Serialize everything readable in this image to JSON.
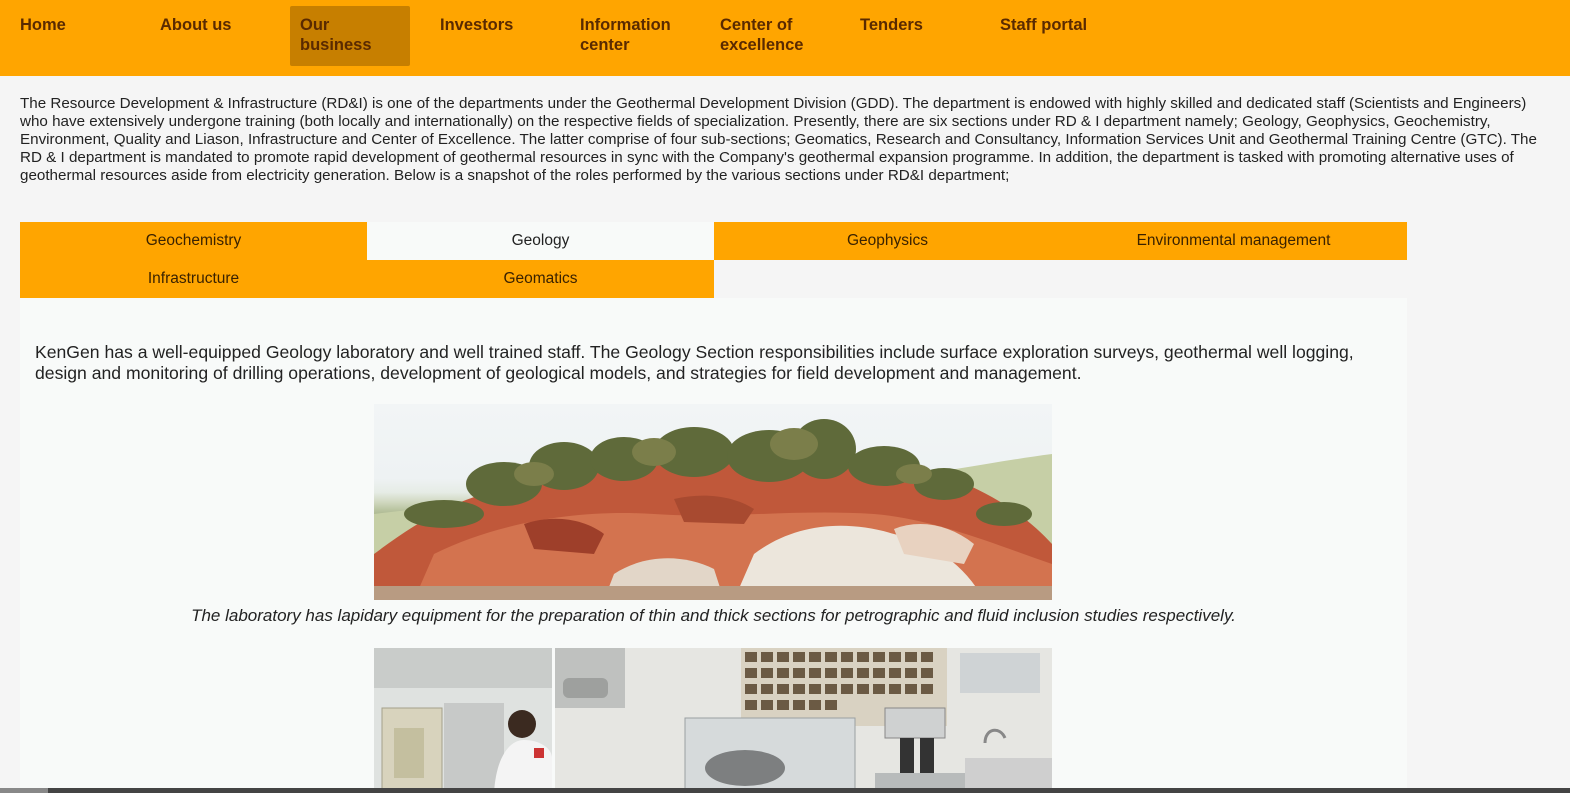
{
  "nav": {
    "items": [
      {
        "label": "Home"
      },
      {
        "label": "About us"
      },
      {
        "label": "Our business"
      },
      {
        "label": "Investors"
      },
      {
        "label": "Information center"
      },
      {
        "label": "Center of excellence"
      },
      {
        "label": "Tenders"
      },
      {
        "label": "Staff portal"
      }
    ],
    "active": "Our business",
    "bar_color": "#ffa500",
    "active_color": "#c77f00"
  },
  "intro": {
    "text": "The Resource Development & Infrastructure (RD&I) is one of the departments under the Geothermal Development Division (GDD). The department is endowed with highly skilled and dedicated staff (Scientists and Engineers) who have extensively undergone training (both locally and internationally) on the respective fields of specialization. Presently, there are six sections under RD & I department namely; Geology, Geophysics, Geochemistry, Environment, Quality and Liason, Infrastructure and Center of Excellence. The latter comprise of four sub-sections; Geomatics, Research and Consultancy, Information Services Unit and Geothermal Training Centre (GTC). The RD & I department is mandated to promote rapid development of geothermal resources in sync with the Company's geothermal expansion programme. In addition, the department is tasked with promoting alternative uses of geothermal resources aside from electricity generation. Below is a snapshot of the roles performed by the various sections under RD&I department;"
  },
  "tabs": {
    "items": [
      {
        "label": "Geochemistry"
      },
      {
        "label": "Geology"
      },
      {
        "label": "Geophysics"
      },
      {
        "label": "Environmental management"
      },
      {
        "label": "Infrastructure"
      },
      {
        "label": "Geomatics"
      }
    ],
    "active": "Geology",
    "tab_color": "#ffa500"
  },
  "panel": {
    "description": "KenGen has a well-equipped Geology laboratory and well trained staff. The Geology Section responsibilities include surface exploration surveys, geothermal well logging, design and monitoring of drilling operations, development of geological models, and strategies for field development and management.",
    "caption": "The laboratory has lapidary equipment for the preparation of thin and thick sections for petrographic and fluid inclusion studies respectively."
  }
}
